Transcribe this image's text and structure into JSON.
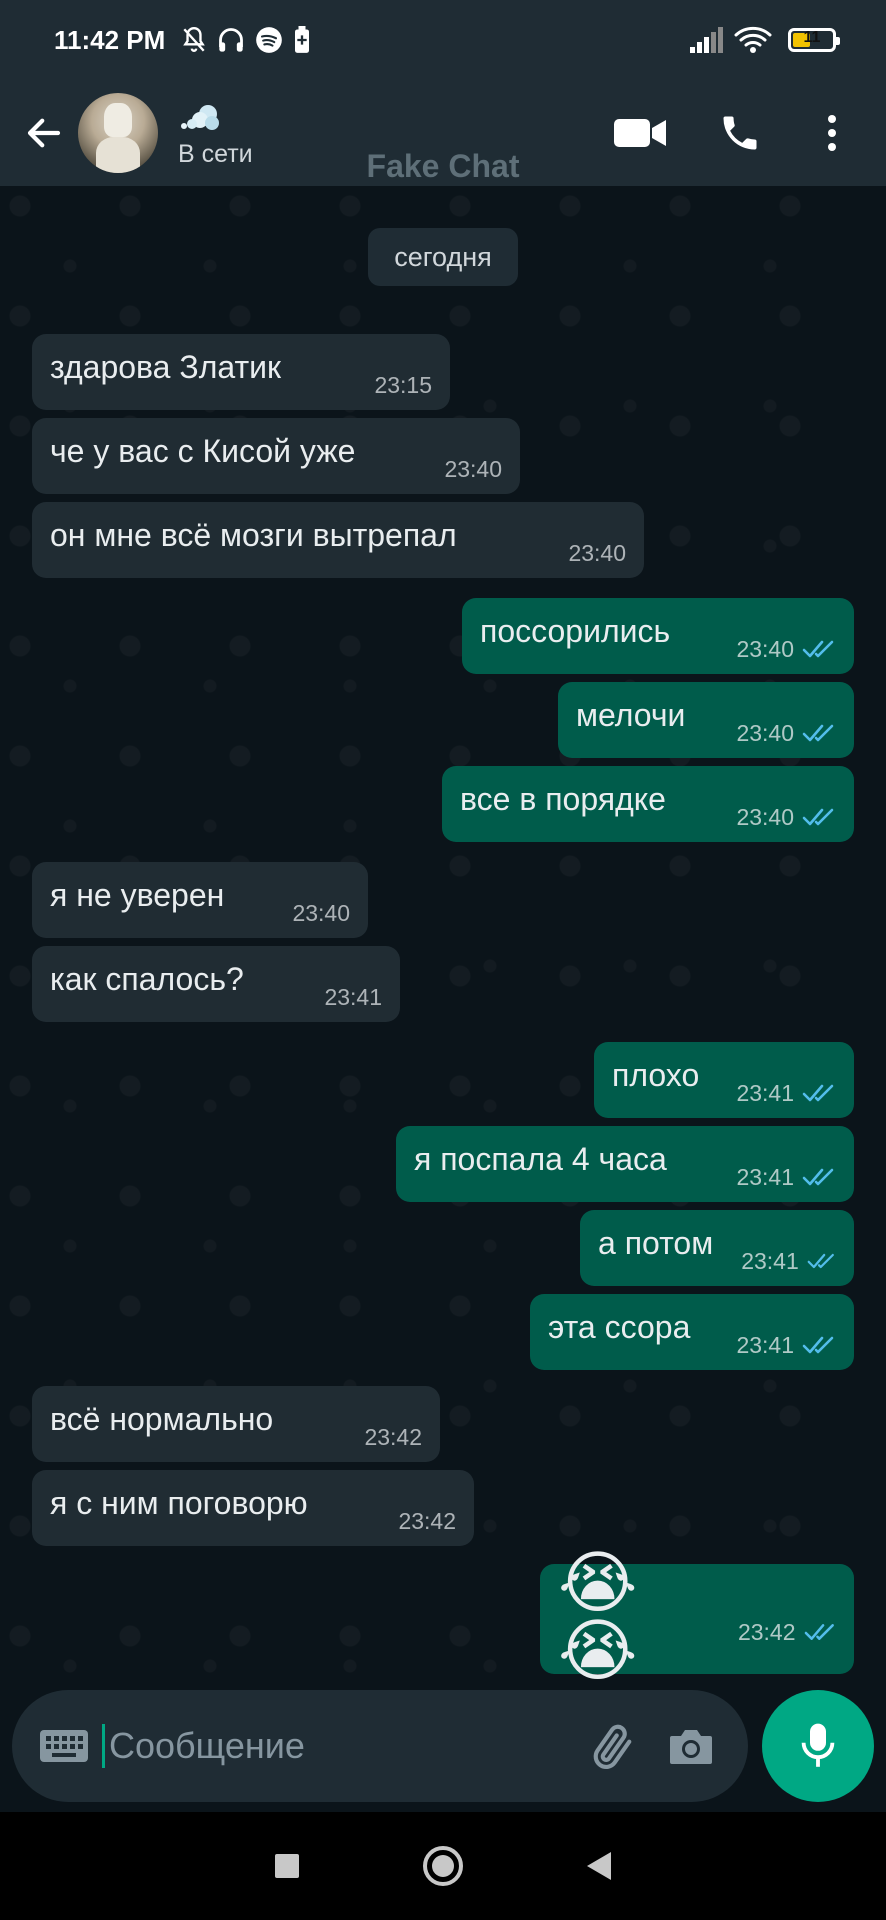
{
  "status_bar": {
    "time": "11:42 PM",
    "battery": "11"
  },
  "header": {
    "contact_name": "",
    "contact_status": "В сети",
    "watermark": "Fake Chat"
  },
  "chat": {
    "date_label": "сегодня",
    "messages": [
      {
        "dir": "in",
        "text": "здарова Златик",
        "time": "23:15"
      },
      {
        "dir": "in",
        "text": "че у вас с Кисой уже",
        "time": "23:40"
      },
      {
        "dir": "in",
        "text": "он мне всё мозги вытрепал",
        "time": "23:40"
      },
      {
        "dir": "out",
        "text": "поссорились",
        "time": "23:40",
        "read": true
      },
      {
        "dir": "out",
        "text": "мелочи",
        "time": "23:40",
        "read": true
      },
      {
        "dir": "out",
        "text": "все в порядке",
        "time": "23:40",
        "read": true
      },
      {
        "dir": "in",
        "text": "я не уверен",
        "time": "23:40"
      },
      {
        "dir": "in",
        "text": "как спалось?",
        "time": "23:41"
      },
      {
        "dir": "out",
        "text": "плохо",
        "time": "23:41",
        "read": true
      },
      {
        "dir": "out",
        "text": "я поспала 4 часа",
        "time": "23:41",
        "read": true
      },
      {
        "dir": "out",
        "text": "а потом",
        "time": "23:41",
        "read": true
      },
      {
        "dir": "out",
        "text": "эта ссора",
        "time": "23:41",
        "read": true
      },
      {
        "dir": "in",
        "text": "всё нормально",
        "time": "23:42"
      },
      {
        "dir": "in",
        "text": "я с ним поговорю",
        "time": "23:42"
      },
      {
        "dir": "out",
        "text": "😭😭",
        "time": "23:42",
        "read": true
      }
    ]
  },
  "input": {
    "placeholder": "Сообщение"
  },
  "colors": {
    "incoming_bubble": "#202c33",
    "outgoing_bubble": "#005c4b",
    "accent": "#00a884",
    "read_ticks": "#53bdeb"
  }
}
